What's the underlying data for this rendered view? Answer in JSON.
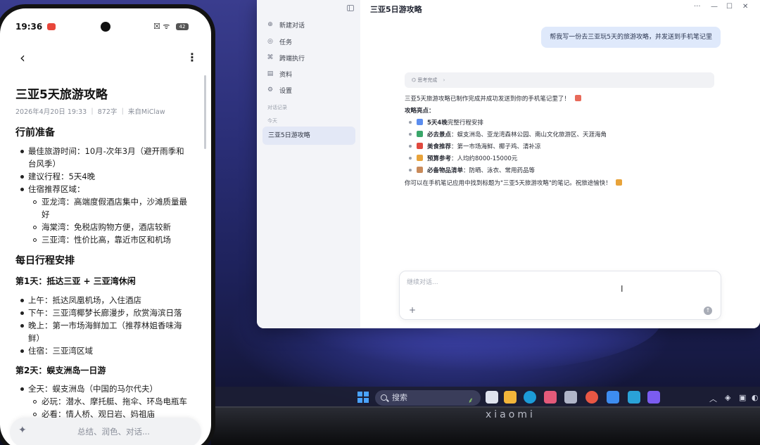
{
  "phone": {
    "status": {
      "time": "19:36",
      "battery": "42"
    },
    "note": {
      "title": "三亚5天旅游攻略",
      "meta": "2026年4月20日 19:33 ｜ 872字 ｜ 来自MiClaw",
      "section1": "行前准备",
      "prep": {
        "best_time_label": "最佳旅游时间：",
        "best_time": "10月-次年3月（避开雨季和",
        "best_time_2": "台风季）",
        "plan": "建议行程：5天4晚",
        "stay_label": "住宿推荐区域：",
        "stay": [
          {
            "line1": "亚龙湾：高端度假酒店集中，沙滩质量最",
            "line2": "好"
          },
          {
            "line1": "海棠湾：免税店购物方便，酒店较新"
          },
          {
            "line1": "三亚湾：性价比高，靠近市区和机场"
          }
        ]
      },
      "section2": "每日行程安排",
      "day1": {
        "title": "第1天：抵达三亚 + 三亚湾休闲",
        "items": [
          "上午：抵达凤凰机场，入住酒店",
          "下午：三亚湾椰梦长廊漫步，欣赏海滨日落",
          "晚上：第一市场海鲜加工（推荐林姐香味海",
          "鲜）",
          "住宿：三亚湾区域"
        ]
      },
      "day2": {
        "title": "第2天：蜈支洲岛一日游",
        "all_day": "全天：蜈支洲岛（中国的马尔代夫）",
        "sub": [
          "必玩：潜水、摩托艇、拖伞、环岛电瓶车",
          "必看：情人桥、观日岩、妈祖庙"
        ]
      }
    },
    "ai_bar": {
      "placeholder": "总结、润色、对话..."
    }
  },
  "window": {
    "title": "三亚5日游攻略",
    "sidebar": {
      "items": [
        {
          "icon": "plus-circle-icon",
          "label": "新建对话"
        },
        {
          "icon": "task-icon",
          "label": "任务"
        },
        {
          "icon": "cross-device-icon",
          "label": "跨端执行"
        },
        {
          "icon": "document-icon",
          "label": "资料"
        },
        {
          "icon": "gear-icon",
          "label": "设置"
        }
      ],
      "history_label": "对话记录",
      "today_label": "今天",
      "active_conversation": "三亚5日游攻略"
    },
    "chat": {
      "user_message": "帮我写一份去三亚玩5天的旅游攻略，并发送到手机笔记里",
      "thinking_label": "思考完成",
      "answer_intro": "三亚5天旅游攻略已制作完成并成功发送到你的手机笔记里了！",
      "highlights_label": "攻略亮点：",
      "highlights": [
        {
          "bold": "5天4晚",
          "text": "完整行程安排",
          "color": "#5b8def"
        },
        {
          "bold": "必去景点",
          "text": "：蜈支洲岛、亚龙湾森林公园、南山文化旅游区、天涯海角",
          "color": "#3aa66a"
        },
        {
          "bold": "美食推荐",
          "text": "：第一市场海鲜、椰子鸡、清补凉",
          "color": "#e0493e"
        },
        {
          "bold": "预算参考",
          "text": "：人均约8000-15000元",
          "color": "#e8a33a"
        },
        {
          "bold": "必备物品清单",
          "text": "：防晒、泳衣、常用药品等",
          "color": "#c98a5a"
        }
      ],
      "answer_outro": "你可以在手机笔记应用中找到标题为\"三亚5天旅游攻略\"的笔记。祝旅途愉快！"
    },
    "composer": {
      "placeholder": "继续对话..."
    }
  },
  "taskbar": {
    "search_label": "搜索",
    "laptop_brand": "xiaomi"
  }
}
